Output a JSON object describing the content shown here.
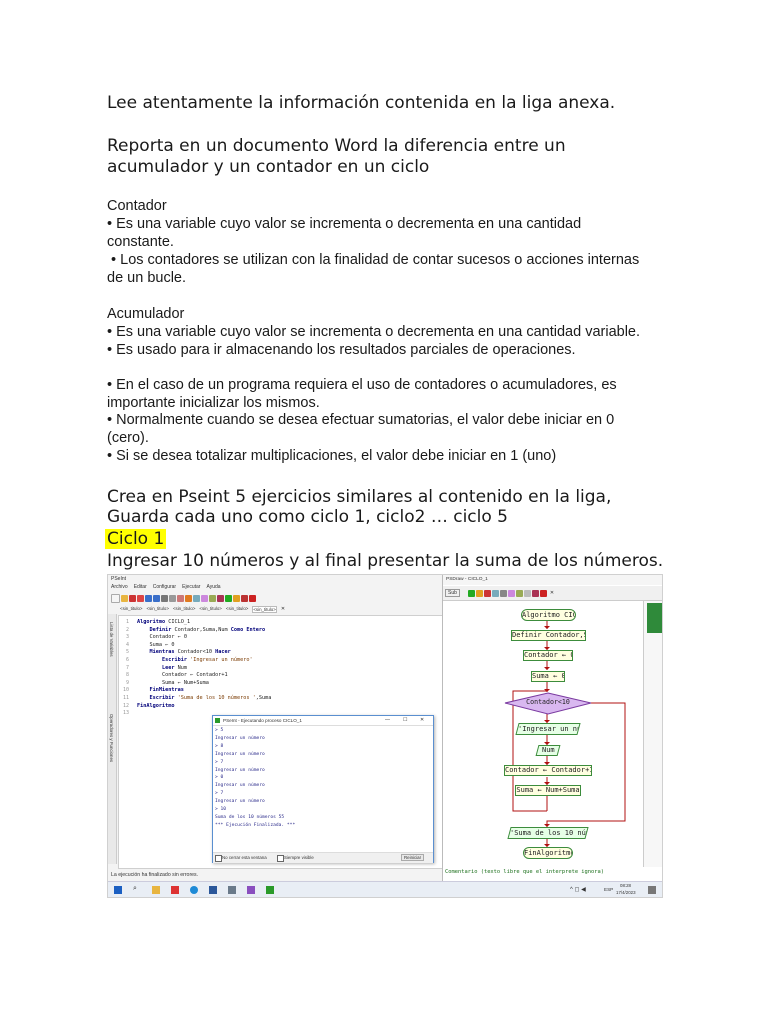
{
  "doc": {
    "line1": "Lee atentamente la información contenida en la liga anexa.",
    "line2a": "Reporta en un documento Word la diferencia entre un",
    "line2b": "acumulador y un contador en un ciclo",
    "contador_title": "Contador",
    "contador_b1a": "• Es una variable cuyo valor se incrementa o decrementa en una cantidad",
    "contador_b1b": "constante.",
    "contador_b2a": " • Los contadores se utilizan con la finalidad de contar sucesos o acciones internas",
    "contador_b2b": "de un bucle.",
    "acum_title": "Acumulador",
    "acum_b1": "• Es una variable cuyo valor se incrementa o decrementa en una cantidad variable.",
    "acum_b2": "• Es usado para ir almacenando los resultados parciales de operaciones.",
    "note1a": "• En el caso de un programa requiera el uso de contadores o acumuladores, es",
    "note1b": "importante inicializar los mismos.",
    "note2a": "• Normalmente cuando se desea efectuar sumatorias, el valor debe iniciar en 0",
    "note2b": "(cero).",
    "note3": "• Si se desea totalizar multiplicaciones, el valor debe iniciar en 1 (uno)",
    "crea_a": "Crea en Pseint 5 ejercicios similares al contenido en la liga,",
    "crea_b": "Guarda cada uno como ciclo 1, ciclo2 … ciclo 5",
    "ciclo1": "Ciclo 1",
    "ingresar": "Ingresar 10 números y al final presentar la suma de los números."
  },
  "screenshot": {
    "app_title": "PSeInt",
    "menu": [
      "Archivo",
      "Editar",
      "Configurar",
      "Ejecutar",
      "Ayuda"
    ],
    "tabs": [
      "<sin_titulo>",
      "<sin_titulo>",
      "<sin_titulo>",
      "<sin_titulo>",
      "<sin_titulo>",
      "<sin_titulo>"
    ],
    "side_labels": [
      "Lista de Variables",
      "Operadores y Funciones"
    ],
    "code_lines": [
      "Algoritmo CICLO_1",
      "    Definir Contador,Suma,Num Como Entero",
      "    Contador ← 0",
      "    Suma ← 0",
      "    Mientras Contador<10 Hacer",
      "        Escribir 'Ingresar un número'",
      "        Leer Num",
      "        Contador ← Contador+1",
      "        Suma ← Num+Suma",
      "    FinMientras",
      "    Escribir 'Suma de los 10 números ',Suma",
      "FinAlgoritmo",
      ""
    ],
    "console_title": "PSeInt - Ejecutando proceso CICLO_1",
    "console_lines": [
      "> 5",
      "Ingresar un número",
      "> 8",
      "Ingresar un número",
      "> 7",
      "Ingresar un número",
      "> 0",
      "Ingresar un número",
      "> 7",
      "Ingresar un número",
      "> 10",
      "Suma de los 10 números 55",
      "*** Ejecución Finalizada. ***"
    ],
    "console_check1": "No cerrar esta ventana",
    "console_check2": "Siempre visible",
    "console_button": "Reiniciar",
    "status_text": "La ejecución ha finalizado sin errores.",
    "flow_title": "PSDraw - CICLO_1",
    "flow_sub": "Sub",
    "flow": {
      "start": "Algoritmo CICLO_1",
      "define": "Definir Contador,Suma,...",
      "init_contador": "Contador ← 0",
      "init_suma": "Suma ← 0",
      "cond": "Contador<10",
      "write1": "'Ingresar un número'",
      "read": "Num",
      "inc": "Contador ← Contador+1",
      "acc": "Suma ← Num+Suma",
      "write2": "'Suma de los 10 número...",
      "end": "FinAlgoritmo",
      "comment": "Comentario (texto libre que el interprete ignora)"
    },
    "tray_lang": "ESP",
    "tray_time": "08:28",
    "tray_date": "17/4/2023"
  }
}
